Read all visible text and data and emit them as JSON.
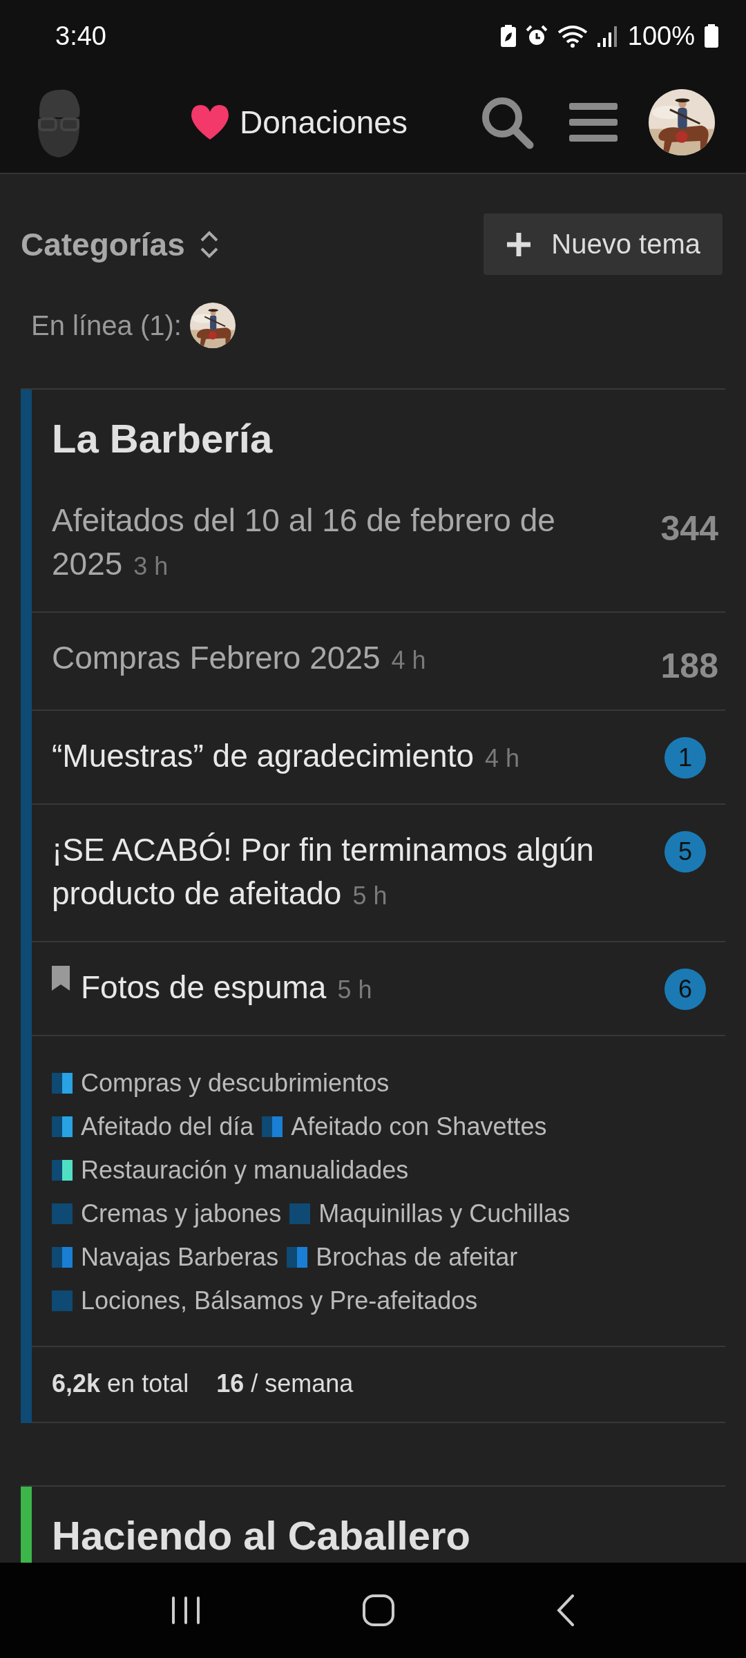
{
  "status_bar": {
    "time": "3:40",
    "battery": "100%"
  },
  "header": {
    "donate_link": "Donaciones"
  },
  "toolbar": {
    "categories_label": "Categorías",
    "new_topic_button": "Nuevo tema"
  },
  "online": {
    "label": "En línea (1):"
  },
  "categories": [
    {
      "name": "La Barbería",
      "color": "#0e4a74",
      "topics": [
        {
          "title": "Afeitados del 10 al 16 de febrero de 2025",
          "age": "3 h",
          "kind": "read",
          "bookmarked": false,
          "count": "344"
        },
        {
          "title": "Compras Febrero 2025",
          "age": "4 h",
          "kind": "read",
          "bookmarked": false,
          "count": "188"
        },
        {
          "title": "“Muestras” de agradecimiento",
          "age": "4 h",
          "kind": "unread",
          "bookmarked": false,
          "count": "1"
        },
        {
          "title": "¡SE ACABÓ! Por fin terminamos algún producto de afeitado",
          "age": "5 h",
          "kind": "unread",
          "bookmarked": false,
          "count": "5"
        },
        {
          "title": "Fotos de espuma",
          "age": "5 h",
          "kind": "unread",
          "bookmarked": true,
          "count": "6"
        }
      ],
      "subcategories": [
        {
          "name": "Compras y descubrimientos",
          "color": "#29a3e3"
        },
        {
          "name": "Afeitado del día",
          "color": "#29a3e3"
        },
        {
          "name": "Afeitado con Shavettes",
          "color": "#1a7fd4"
        },
        {
          "name": "Restauración y manualidades",
          "color": "#4fe0c4"
        },
        {
          "name": "Cremas y jabones",
          "color": "#0e4a74"
        },
        {
          "name": "Maquinillas y Cuchillas",
          "color": "#0e4a74"
        },
        {
          "name": "Navajas Barberas",
          "color": "#1a7fd4"
        },
        {
          "name": "Brochas de afeitar",
          "color": "#1a7fd4"
        },
        {
          "name": "Lociones, Bálsamos y Pre-afeitados",
          "color": "#0e4a74"
        }
      ],
      "stats": [
        "**6,2k** en total",
        "**16** / semana"
      ]
    },
    {
      "name": "Haciendo al Caballero",
      "color": "#3cb64a"
    }
  ]
}
